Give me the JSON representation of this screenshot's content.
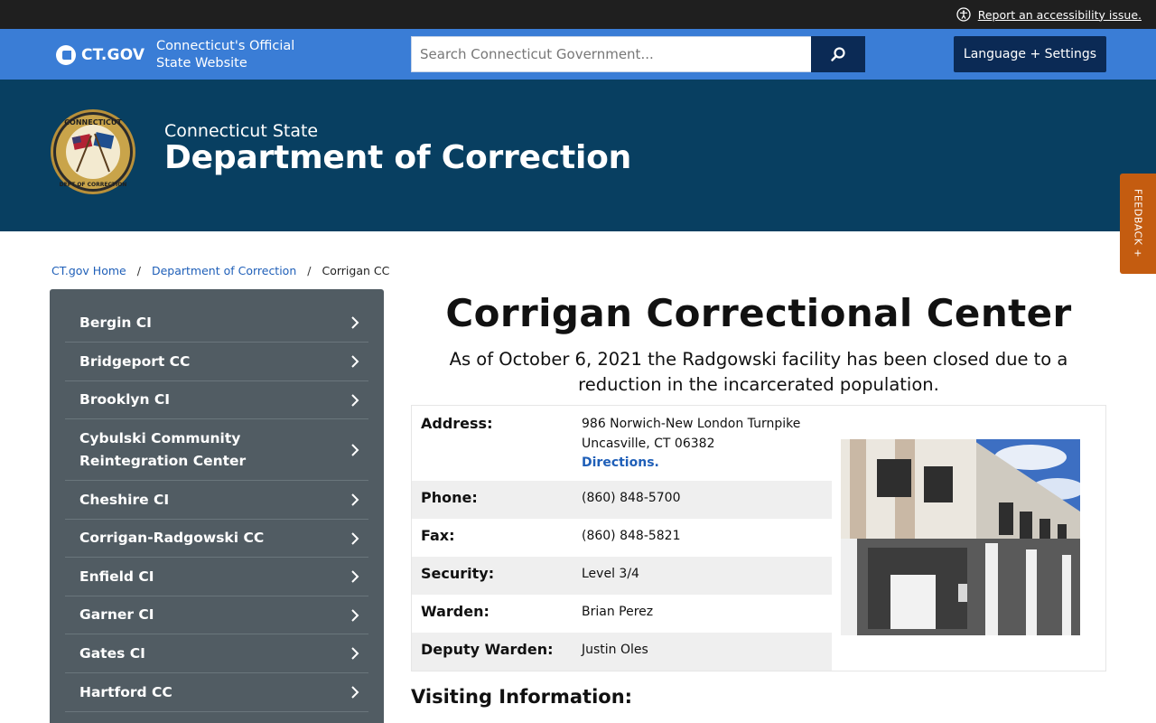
{
  "utility": {
    "accessibility_link": "Report an accessibility issue."
  },
  "gov": {
    "logo_text": "CT.GOV",
    "tagline": "Connecticut's Official State Website",
    "search_placeholder": "Search Connecticut Government...",
    "language_button": "Language + Settings"
  },
  "agency": {
    "subtitle": "Connecticut State",
    "title": "Department of Correction",
    "seal_icon": "doc-seal-icon"
  },
  "feedback": {
    "label": "FEEDBACK +"
  },
  "breadcrumb": {
    "items": [
      "CT.gov Home",
      "Department of Correction"
    ],
    "current": "Corrigan CC",
    "separator": "/"
  },
  "sidebar": {
    "items": [
      "Bergin CI",
      "Bridgeport CC",
      "Brooklyn CI",
      "Cybulski Community Reintegration Center",
      "Cheshire CI",
      "Corrigan-Radgowski CC",
      "Enfield CI",
      "Garner CI",
      "Gates CI",
      "Hartford CC"
    ]
  },
  "main": {
    "title": "Corrigan Correctional Center",
    "notice": "As of October 6, 2021 the Radgowski facility has been closed due to a reduction in the incarcerated population.",
    "info": {
      "address_label": "Address:",
      "address_line1": "986 Norwich-New London Turnpike",
      "address_line2": "Uncasville, CT 06382",
      "directions": "Directions.",
      "phone_label": "Phone:",
      "phone": "(860) 848-5700",
      "fax_label": "Fax:",
      "fax": "(860) 848-5821",
      "security_label": "Security:",
      "security": "Level 3/4",
      "warden_label": "Warden:",
      "warden": "Brian Perez",
      "deputy_label": "Deputy Warden:",
      "deputy": "Justin Oles"
    },
    "visiting_heading": "Visiting Information:"
  },
  "colors": {
    "utility_bar": "#1f1f1f",
    "gov_blue": "#3a7dd6",
    "navy": "#0b2a55",
    "agency_banner": "#083f61",
    "sidebar": "#515c63",
    "feedback": "#c45c10",
    "link": "#1f5fb8"
  }
}
